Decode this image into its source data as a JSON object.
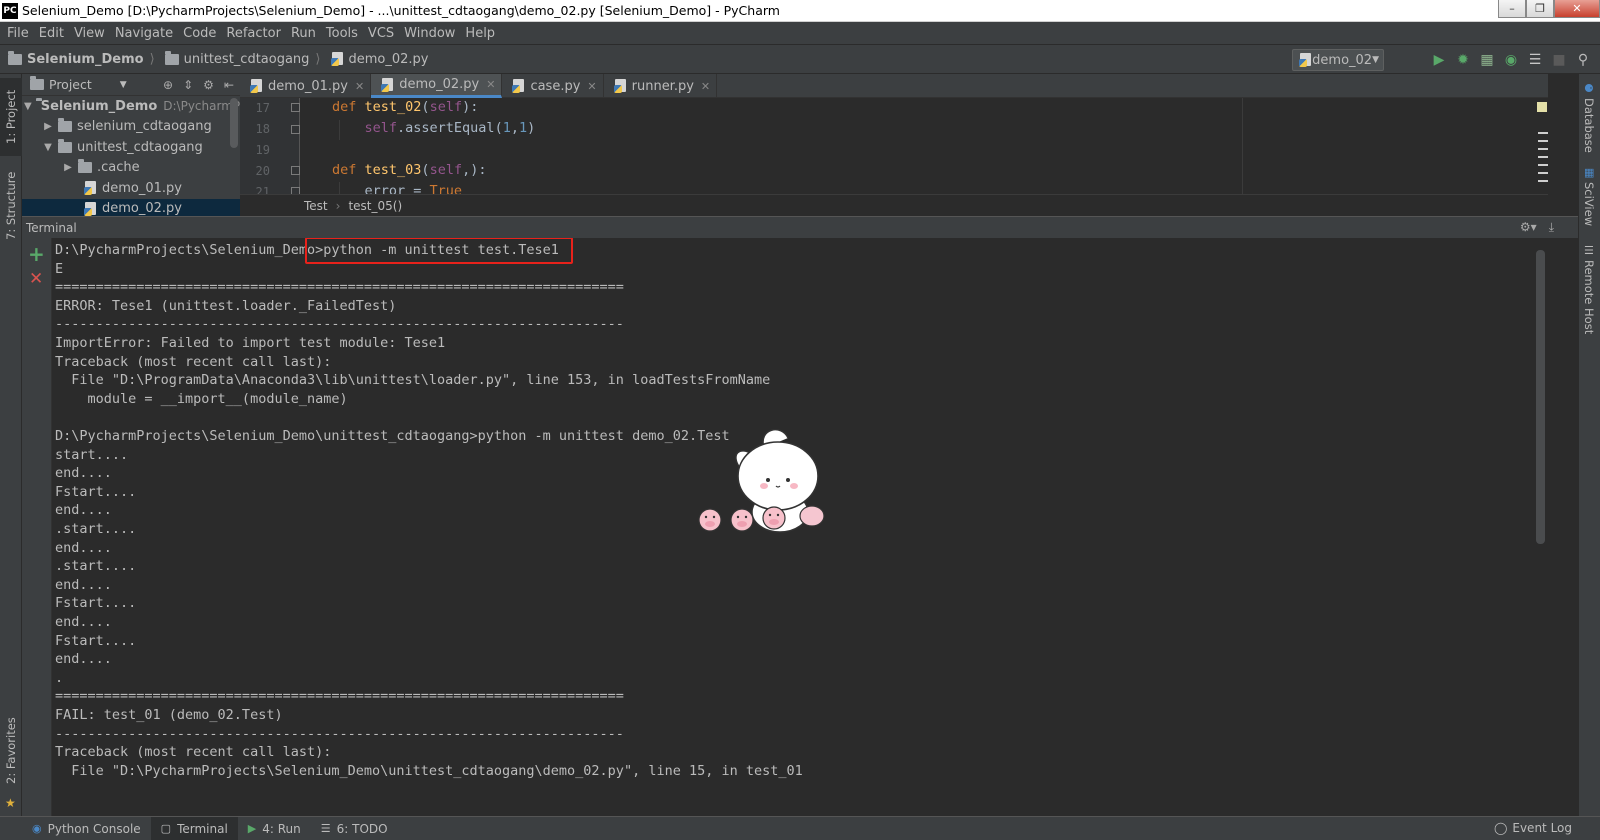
{
  "window": {
    "app_icon": "PC",
    "title": "Selenium_Demo [D:\\PycharmProjects\\Selenium_Demo] - ...\\unittest_cdtaogang\\demo_02.py [Selenium_Demo] - PyCharm",
    "controls": [
      "minimize-icon",
      "restore-icon",
      "close-icon"
    ]
  },
  "menu": [
    "File",
    "Edit",
    "View",
    "Navigate",
    "Code",
    "Refactor",
    "Run",
    "Tools",
    "VCS",
    "Window",
    "Help"
  ],
  "navbar": {
    "breadcrumbs": [
      "Selenium_Demo",
      "unittest_cdtaogang",
      "demo_02.py"
    ],
    "run_config": "demo_02",
    "toolbar_icons": [
      "run-icon",
      "debug-icon",
      "coverage-icon",
      "profile-icon",
      "run-list-icon",
      "stop-icon",
      "search-icon"
    ]
  },
  "left_tabs": [
    "1: Project",
    "7: Structure",
    "2: Favorites"
  ],
  "right_tabs": [
    "Database",
    "SciView",
    "Remote Host"
  ],
  "project": {
    "header": "Project",
    "tree": [
      {
        "label": "Selenium_Demo",
        "suffix": "D:\\PycharmPr",
        "type": "folder",
        "expanded": true,
        "level": 0
      },
      {
        "label": "selenium_cdtaogang",
        "type": "folder",
        "expanded": false,
        "level": 1
      },
      {
        "label": "unittest_cdtaogang",
        "type": "folder",
        "expanded": true,
        "level": 1
      },
      {
        "label": ".cache",
        "type": "folder",
        "expanded": false,
        "level": 2
      },
      {
        "label": "demo_01.py",
        "type": "py",
        "level": 2
      },
      {
        "label": "demo_02.py",
        "type": "py",
        "level": 2,
        "selected": true
      }
    ]
  },
  "editor": {
    "tabs": [
      {
        "label": "demo_01.py",
        "active": false
      },
      {
        "label": "demo_02.py",
        "active": true
      },
      {
        "label": "case.py",
        "active": false
      },
      {
        "label": "runner.py",
        "active": false
      }
    ],
    "line_numbers": [
      "17",
      "18",
      "19",
      "20",
      "21"
    ],
    "breadcrumbs": [
      "Test",
      "test_05()"
    ]
  },
  "terminal": {
    "title": "Terminal",
    "prompt": "D:\\PycharmProjects\\Selenium_Demo>",
    "highlighted_command": "python -m unittest test.Tese1",
    "lines": [
      "E",
      "======================================================================",
      "ERROR: Tese1 (unittest.loader._FailedTest)",
      "----------------------------------------------------------------------",
      "ImportError: Failed to import test module: Tese1",
      "Traceback (most recent call last):",
      "  File \"D:\\ProgramData\\Anaconda3\\lib\\unittest\\loader.py\", line 153, in loadTestsFromName",
      "    module = __import__(module_name)",
      "",
      "D:\\PycharmProjects\\Selenium_Demo\\unittest_cdtaogang>python -m unittest demo_02.Test",
      "start....",
      "end....",
      "Fstart....",
      "end....",
      ".start....",
      "end....",
      ".start....",
      "end....",
      "Fstart....",
      "end....",
      "Fstart....",
      "end....",
      ".",
      "======================================================================",
      "FAIL: test_01 (demo_02.Test)",
      "----------------------------------------------------------------------",
      "Traceback (most recent call last):",
      "  File \"D:\\PycharmProjects\\Selenium_Demo\\unittest_cdtaogang\\demo_02.py\", line 15, in test_01"
    ]
  },
  "statusbar": {
    "tabs": [
      {
        "label": "Python Console",
        "icon": "python-console-icon"
      },
      {
        "label": "Terminal",
        "icon": "terminal-icon",
        "active": true
      },
      {
        "label": "4: Run",
        "icon": "run-icon"
      },
      {
        "label": "6: TODO",
        "icon": "todo-icon"
      }
    ],
    "event_log": "Event Log"
  },
  "colors": {
    "background": "#2b2b2b",
    "panel": "#3c3f41",
    "highlight_box": "#e8221b",
    "keyword": "#cc7832",
    "function": "#ffc66d",
    "self": "#94558d",
    "number": "#6897bb"
  }
}
